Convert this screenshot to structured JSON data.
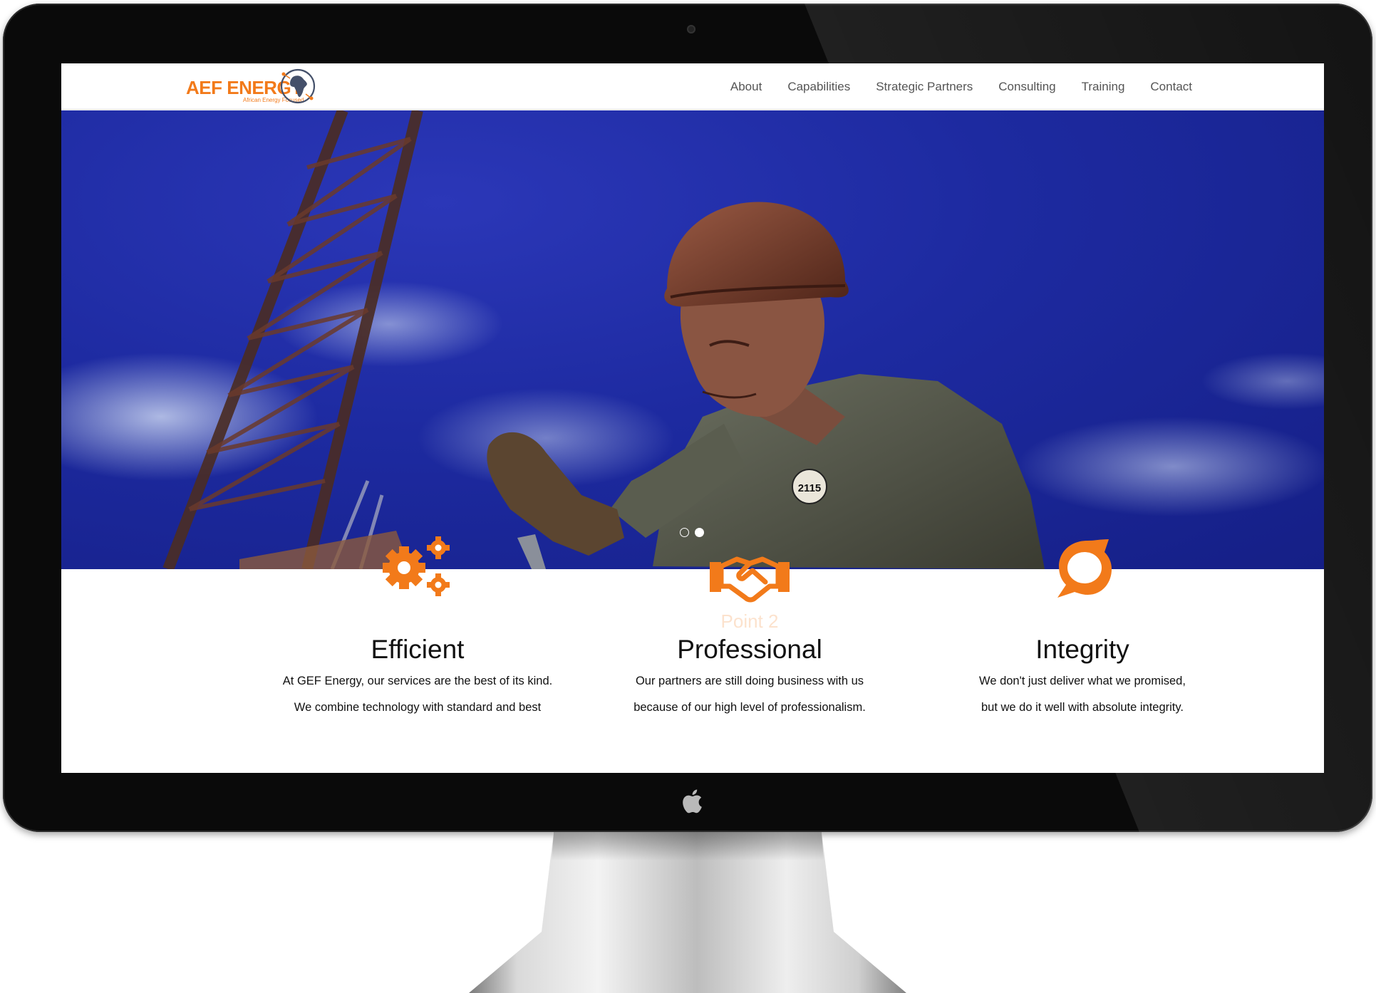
{
  "site": {
    "logo": {
      "brand": "AEF ENERGY",
      "tagline": "African Energy Focused"
    },
    "nav": [
      {
        "label": "About"
      },
      {
        "label": "Capabilities"
      },
      {
        "label": "Strategic Partners"
      },
      {
        "label": "Consulting"
      },
      {
        "label": "Training"
      },
      {
        "label": "Contact"
      }
    ],
    "hero": {
      "badge_number": "2115",
      "slides": 2,
      "active_slide": 2
    },
    "features": [
      {
        "icon": "gears-icon",
        "title": "Efficient",
        "lines": [
          "At GEF Energy, our services are the best of its kind.",
          "We combine technology with standard and best"
        ]
      },
      {
        "icon": "handshake-icon",
        "title": "Professional",
        "ghost_label": "Point 2",
        "lines": [
          "Our partners are still doing business with us",
          "because of our high level of professionalism."
        ]
      },
      {
        "icon": "speech-swirl-icon",
        "title": "Integrity",
        "lines": [
          "We don't just deliver what we promised,",
          "but we do it well with absolute integrity."
        ]
      }
    ]
  },
  "colors": {
    "accent": "#f27a1a",
    "hero_sky": "#1d2aa0",
    "nav_text": "#555555"
  }
}
